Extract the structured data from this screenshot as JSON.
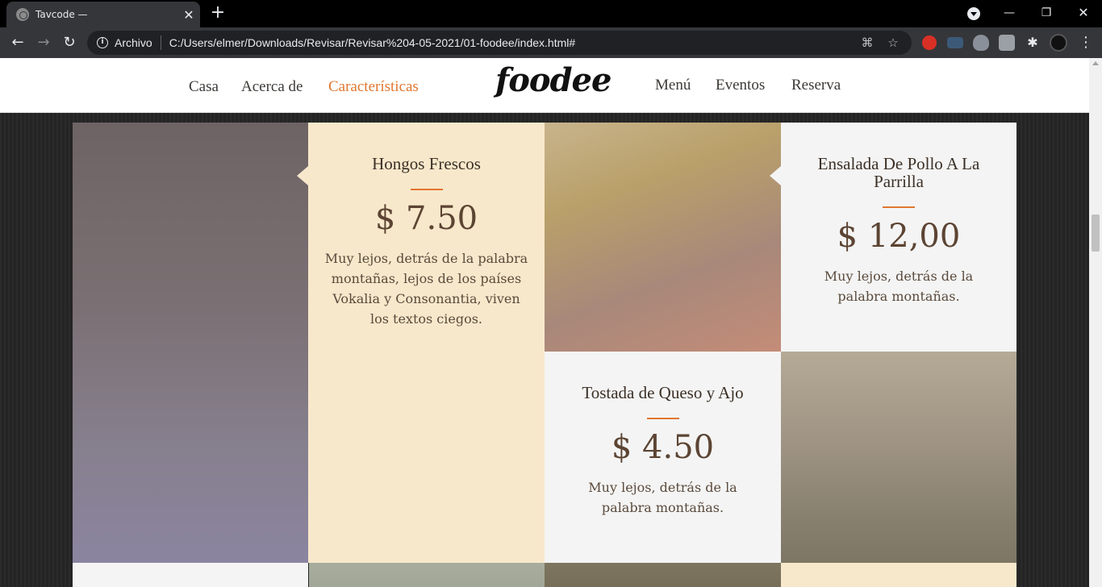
{
  "browser": {
    "tab_title": "Tavcode —",
    "omnibox_scheme": "Archivo",
    "url": "C:/Users/elmer/Downloads/Revisar/Revisar%204-05-2021/01-foodee/index.html#"
  },
  "site": {
    "logo": "foodee",
    "nav_left": [
      "Casa",
      "Acerca de",
      "Características"
    ],
    "nav_right": [
      "Menú",
      "Eventos",
      "Reserva"
    ],
    "active_nav": "Características",
    "accent_color": "#e2772f"
  },
  "menu_items": [
    {
      "name": "Hongos Frescos",
      "price": "$ 7.50",
      "description": "Muy lejos, detrás de la palabra montañas, lejos de los países Vokalia y Consonantia, viven los textos ciegos."
    },
    {
      "name": "Ensalada De Pollo A La Parrilla",
      "price": "$ 12,00",
      "description": "Muy lejos, detrás de la palabra montañas."
    },
    {
      "name": "Tostada de Queso y Ajo",
      "price": "$ 4.50",
      "description": "Muy lejos, detrás de la palabra montañas."
    }
  ]
}
